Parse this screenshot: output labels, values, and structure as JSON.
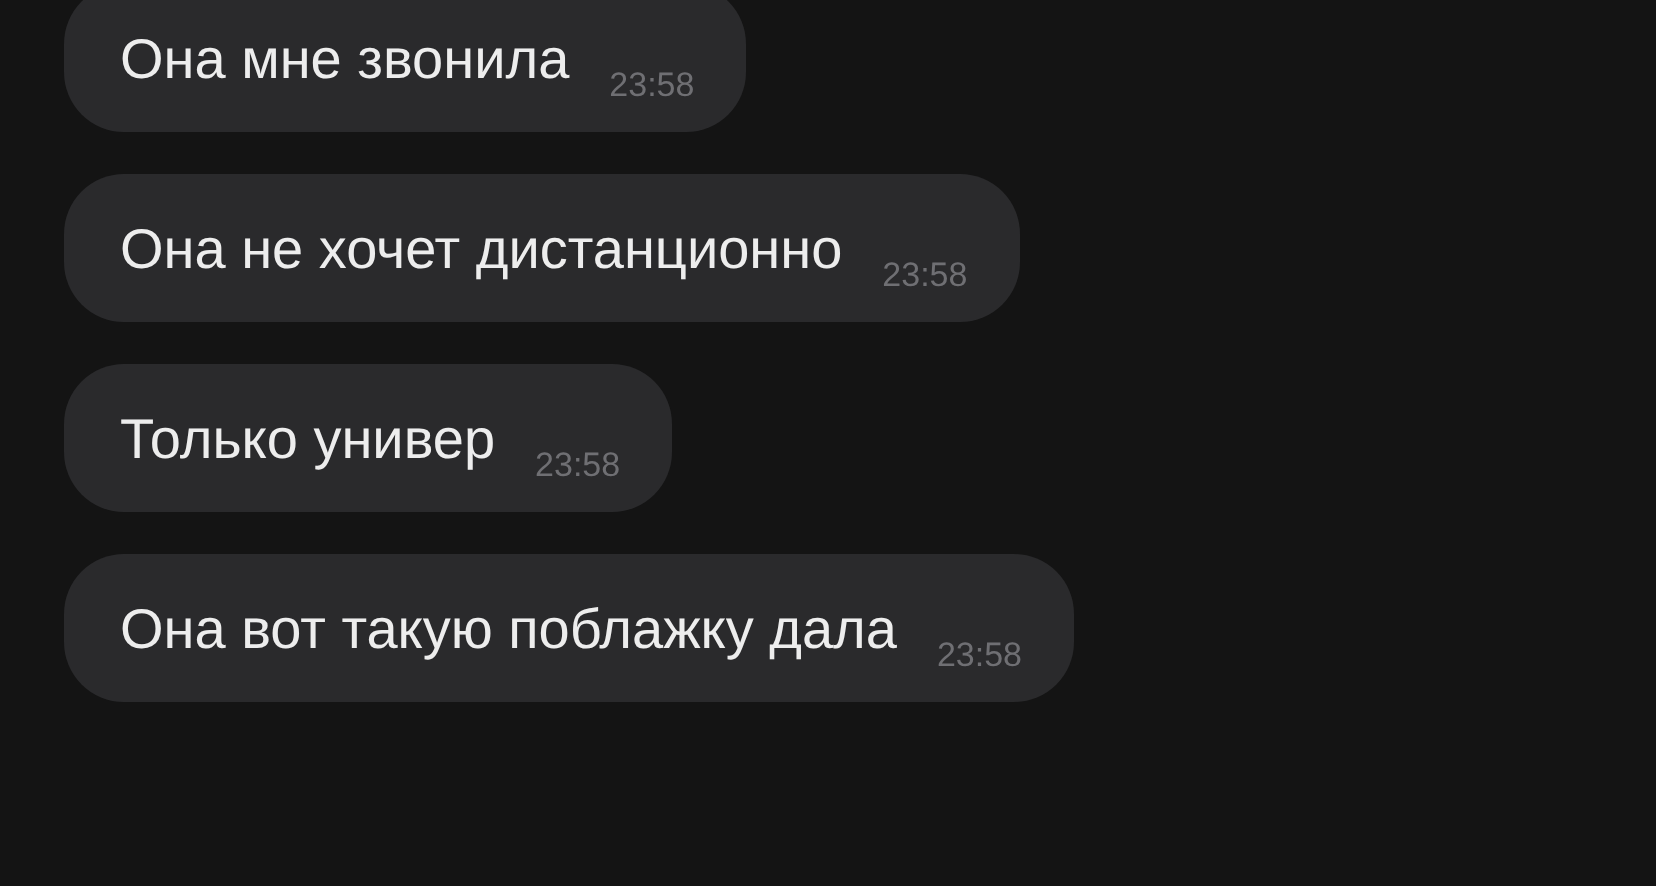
{
  "messages": [
    {
      "text": "Она мне звонила",
      "time": "23:58"
    },
    {
      "text": "Она не хочет дистанционно",
      "time": "23:58"
    },
    {
      "text": "Только универ",
      "time": "23:58"
    },
    {
      "text": "Она вот такую поблажку дала",
      "time": "23:58"
    }
  ]
}
